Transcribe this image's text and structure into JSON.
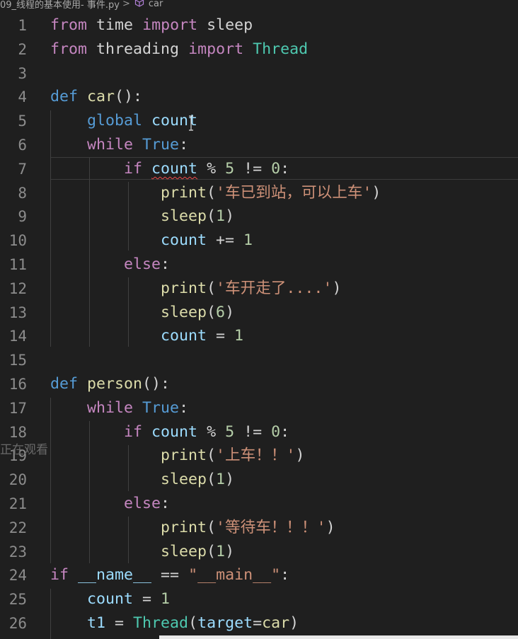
{
  "breadcrumb": {
    "file": "09_线程的基本使用- 事件.py",
    "separator": ">",
    "symbol": "car"
  },
  "overlay_text": "正在观看",
  "lines": [
    {
      "n": "1",
      "tokens": [
        [
          "kw2",
          "from"
        ],
        [
          "plain",
          " "
        ],
        [
          "plain",
          "time"
        ],
        [
          "plain",
          " "
        ],
        [
          "kw2",
          "import"
        ],
        [
          "plain",
          " "
        ],
        [
          "plain",
          "sleep"
        ]
      ]
    },
    {
      "n": "2",
      "tokens": [
        [
          "kw2",
          "from"
        ],
        [
          "plain",
          " "
        ],
        [
          "plain",
          "threading"
        ],
        [
          "plain",
          " "
        ],
        [
          "kw2",
          "import"
        ],
        [
          "plain",
          " "
        ],
        [
          "cls",
          "Thread"
        ]
      ]
    },
    {
      "n": "3",
      "tokens": []
    },
    {
      "n": "4",
      "tokens": [
        [
          "kw",
          "def"
        ],
        [
          "plain",
          " "
        ],
        [
          "fn",
          "car"
        ],
        [
          "plain",
          "():"
        ]
      ]
    },
    {
      "n": "5",
      "tokens": [
        [
          "plain",
          "    "
        ],
        [
          "kw",
          "global"
        ],
        [
          "plain",
          " "
        ],
        [
          "var",
          "count"
        ]
      ]
    },
    {
      "n": "6",
      "tokens": [
        [
          "plain",
          "    "
        ],
        [
          "kw2",
          "while"
        ],
        [
          "plain",
          " "
        ],
        [
          "kw",
          "True"
        ],
        [
          "plain",
          ":"
        ]
      ]
    },
    {
      "n": "7",
      "tokens": [
        [
          "plain",
          "        "
        ],
        [
          "kw2",
          "if"
        ],
        [
          "plain",
          " "
        ],
        [
          "var squig",
          "count"
        ],
        [
          "plain",
          " % "
        ],
        [
          "num",
          "5"
        ],
        [
          "plain",
          " != "
        ],
        [
          "num",
          "0"
        ],
        [
          "plain",
          ":"
        ]
      ]
    },
    {
      "n": "8",
      "tokens": [
        [
          "plain",
          "            "
        ],
        [
          "fn",
          "print"
        ],
        [
          "plain",
          "("
        ],
        [
          "str",
          "'车已到站，可以上车'"
        ],
        [
          "plain",
          ")"
        ]
      ]
    },
    {
      "n": "9",
      "tokens": [
        [
          "plain",
          "            "
        ],
        [
          "fn",
          "sleep"
        ],
        [
          "plain",
          "("
        ],
        [
          "num",
          "1"
        ],
        [
          "plain",
          ")"
        ]
      ]
    },
    {
      "n": "10",
      "tokens": [
        [
          "plain",
          "            "
        ],
        [
          "var",
          "count"
        ],
        [
          "plain",
          " += "
        ],
        [
          "num",
          "1"
        ]
      ]
    },
    {
      "n": "11",
      "tokens": [
        [
          "plain",
          "        "
        ],
        [
          "kw2",
          "else"
        ],
        [
          "plain",
          ":"
        ]
      ]
    },
    {
      "n": "12",
      "tokens": [
        [
          "plain",
          "            "
        ],
        [
          "fn",
          "print"
        ],
        [
          "plain",
          "("
        ],
        [
          "str",
          "'车开走了....'"
        ],
        [
          "plain",
          ")"
        ]
      ]
    },
    {
      "n": "13",
      "tokens": [
        [
          "plain",
          "            "
        ],
        [
          "fn",
          "sleep"
        ],
        [
          "plain",
          "("
        ],
        [
          "num",
          "6"
        ],
        [
          "plain",
          ")"
        ]
      ]
    },
    {
      "n": "14",
      "tokens": [
        [
          "plain",
          "            "
        ],
        [
          "var",
          "count"
        ],
        [
          "plain",
          " = "
        ],
        [
          "num",
          "1"
        ]
      ]
    },
    {
      "n": "15",
      "tokens": []
    },
    {
      "n": "16",
      "tokens": [
        [
          "kw",
          "def"
        ],
        [
          "plain",
          " "
        ],
        [
          "fn",
          "person"
        ],
        [
          "plain",
          "():"
        ]
      ]
    },
    {
      "n": "17",
      "tokens": [
        [
          "plain",
          "    "
        ],
        [
          "kw2",
          "while"
        ],
        [
          "plain",
          " "
        ],
        [
          "kw",
          "True"
        ],
        [
          "plain",
          ":"
        ]
      ]
    },
    {
      "n": "18",
      "tokens": [
        [
          "plain",
          "        "
        ],
        [
          "kw2",
          "if"
        ],
        [
          "plain",
          " "
        ],
        [
          "var",
          "count"
        ],
        [
          "plain",
          " % "
        ],
        [
          "num",
          "5"
        ],
        [
          "plain",
          " != "
        ],
        [
          "num",
          "0"
        ],
        [
          "plain",
          ":"
        ]
      ]
    },
    {
      "n": "19",
      "tokens": [
        [
          "plain",
          "            "
        ],
        [
          "fn",
          "print"
        ],
        [
          "plain",
          "("
        ],
        [
          "str",
          "'上车！！'"
        ],
        [
          "plain",
          ")"
        ]
      ]
    },
    {
      "n": "20",
      "tokens": [
        [
          "plain",
          "            "
        ],
        [
          "fn",
          "sleep"
        ],
        [
          "plain",
          "("
        ],
        [
          "num",
          "1"
        ],
        [
          "plain",
          ")"
        ]
      ]
    },
    {
      "n": "21",
      "tokens": [
        [
          "plain",
          "        "
        ],
        [
          "kw2",
          "else"
        ],
        [
          "plain",
          ":"
        ]
      ]
    },
    {
      "n": "22",
      "tokens": [
        [
          "plain",
          "            "
        ],
        [
          "fn",
          "print"
        ],
        [
          "plain",
          "("
        ],
        [
          "str",
          "'等待车！！！'"
        ],
        [
          "plain",
          ")"
        ]
      ]
    },
    {
      "n": "23",
      "tokens": [
        [
          "plain",
          "            "
        ],
        [
          "fn",
          "sleep"
        ],
        [
          "plain",
          "("
        ],
        [
          "num",
          "1"
        ],
        [
          "plain",
          ")"
        ]
      ]
    },
    {
      "n": "24",
      "tokens": [
        [
          "kw2",
          "if"
        ],
        [
          "plain",
          " "
        ],
        [
          "var",
          "__name__"
        ],
        [
          "plain",
          " == "
        ],
        [
          "str",
          "\"__main__\""
        ],
        [
          "plain",
          ":"
        ]
      ]
    },
    {
      "n": "25",
      "tokens": [
        [
          "plain",
          "    "
        ],
        [
          "var",
          "count"
        ],
        [
          "plain",
          " = "
        ],
        [
          "num",
          "1"
        ]
      ]
    },
    {
      "n": "26",
      "tokens": [
        [
          "plain",
          "    "
        ],
        [
          "var",
          "t1"
        ],
        [
          "plain",
          " = "
        ],
        [
          "cls",
          "Thread"
        ],
        [
          "plain",
          "("
        ],
        [
          "var",
          "target"
        ],
        [
          "plain",
          "="
        ],
        [
          "fn",
          "car"
        ],
        [
          "plain",
          ")"
        ]
      ]
    }
  ]
}
